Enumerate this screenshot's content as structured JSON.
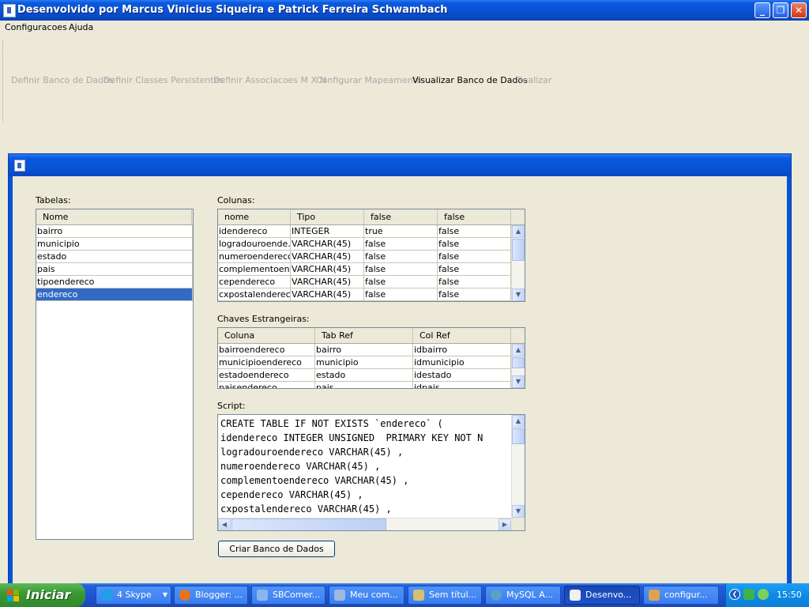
{
  "window": {
    "title": "Desenvolvido por Marcus Vinicius Siqueira e Patrick Ferreira Schwambach",
    "buttons": {
      "minimize": "_",
      "maximize": "❐",
      "close": "✕"
    }
  },
  "menu": [
    "Configuracoes",
    "Ajuda"
  ],
  "wizard_steps": [
    {
      "label": "Definir Banco de Dados",
      "active": false
    },
    {
      "label": "Definir Classes Persistentes",
      "active": false
    },
    {
      "label": "Definir Associacoes M X N",
      "active": false
    },
    {
      "label": "Configurar Mapeamento",
      "active": false
    },
    {
      "label": "Visualizar Banco de Dados",
      "active": true
    },
    {
      "label": "Finalizar",
      "active": false
    }
  ],
  "tabelas": {
    "label": "Tabelas:",
    "header": "Nome",
    "rows": [
      "bairro",
      "municipio",
      "estado",
      "pais",
      "tipoendereco",
      "endereco"
    ],
    "selected": "endereco"
  },
  "colunas": {
    "label": "Colunas:",
    "headers": [
      "nome",
      "Tipo",
      "false",
      "false"
    ],
    "rows": [
      [
        "idendereco",
        "INTEGER",
        "true",
        "false"
      ],
      [
        "logradouroende...",
        "VARCHAR(45)",
        "false",
        "false"
      ],
      [
        "numeroendereco",
        "VARCHAR(45)",
        "false",
        "false"
      ],
      [
        "complementoen...",
        "VARCHAR(45)",
        "false",
        "false"
      ],
      [
        "cependereco",
        "VARCHAR(45)",
        "false",
        "false"
      ],
      [
        "cxpostalendereco",
        "VARCHAR(45)",
        "false",
        "false"
      ]
    ]
  },
  "chaves": {
    "label": "Chaves Estrangeiras:",
    "headers": [
      "Coluna",
      "Tab Ref",
      "Col Ref"
    ],
    "rows": [
      [
        "bairroendereco",
        "bairro",
        "idbairro"
      ],
      [
        "municipioendereco",
        "municipio",
        "idmunicipio"
      ],
      [
        "estadoendereco",
        "estado",
        "idestado"
      ],
      [
        "paisendereco",
        "pais",
        "idpais"
      ]
    ]
  },
  "script": {
    "label": "Script:",
    "lines": [
      "CREATE TABLE IF NOT EXISTS `endereco` (",
      "idendereco INTEGER UNSIGNED  PRIMARY KEY NOT N",
      "logradouroendereco VARCHAR(45) ,",
      "numeroendereco VARCHAR(45) ,",
      "complementoendereco VARCHAR(45) ,",
      "cependereco VARCHAR(45) ,",
      "cxpostalendereco VARCHAR(45) ,"
    ]
  },
  "create_button": "Criar Banco de Dados",
  "taskbar": {
    "start": "Iniciar",
    "tasks": [
      {
        "label": "4 Skype",
        "icon": "skype-icon",
        "color": "#1ea0e8"
      },
      {
        "label": "Blogger: ...",
        "icon": "firefox-icon",
        "color": "#e8731e"
      },
      {
        "label": "SBComer...",
        "icon": "window-icon",
        "color": "#8ab6f0"
      },
      {
        "label": "Meu com...",
        "icon": "computer-icon",
        "color": "#9fb8e0"
      },
      {
        "label": "Sem títul...",
        "icon": "paint-icon",
        "color": "#d8c070"
      },
      {
        "label": "MySQL A...",
        "icon": "mysql-icon",
        "color": "#58a0c8"
      },
      {
        "label": "Desenvo...",
        "icon": "java-icon",
        "color": "#f0f0f0",
        "active": true
      },
      {
        "label": "configur...",
        "icon": "java-cup-icon",
        "color": "#e0a050"
      }
    ],
    "clock": "15:50"
  }
}
